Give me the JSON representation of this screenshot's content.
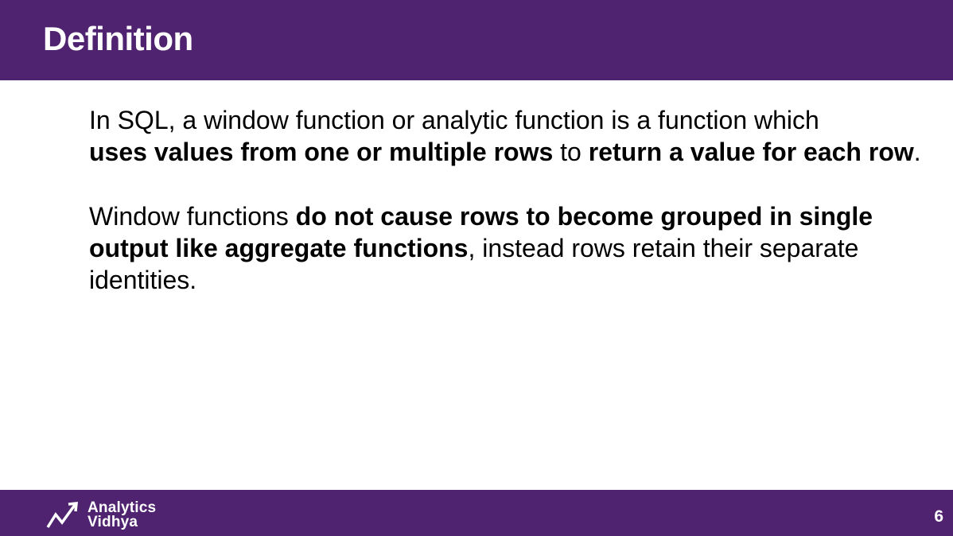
{
  "header": {
    "title": "Definition"
  },
  "content": {
    "paragraph1": {
      "line1": "In SQL, a window function or analytic function is a function which",
      "line2_bold1": "uses values from one or multiple rows",
      "line2_plain": " to ",
      "line2_bold2": "return a value for each row",
      "line2_end": "."
    },
    "paragraph2": {
      "line1_plain": "Window functions ",
      "line1_bold": "do not cause rows to become grouped in single",
      "line2_bold": "output like aggregate functions",
      "line2_plain": ", instead rows retain their separate",
      "line3": "identities."
    }
  },
  "footer": {
    "logo_line1": "Analytics",
    "logo_line2": "Vidhya",
    "logo_icon": "trend-arrow-icon",
    "page_number": "6"
  },
  "colors": {
    "brand_purple": "#4f2370",
    "text": "#000000",
    "on_brand": "#ffffff"
  }
}
